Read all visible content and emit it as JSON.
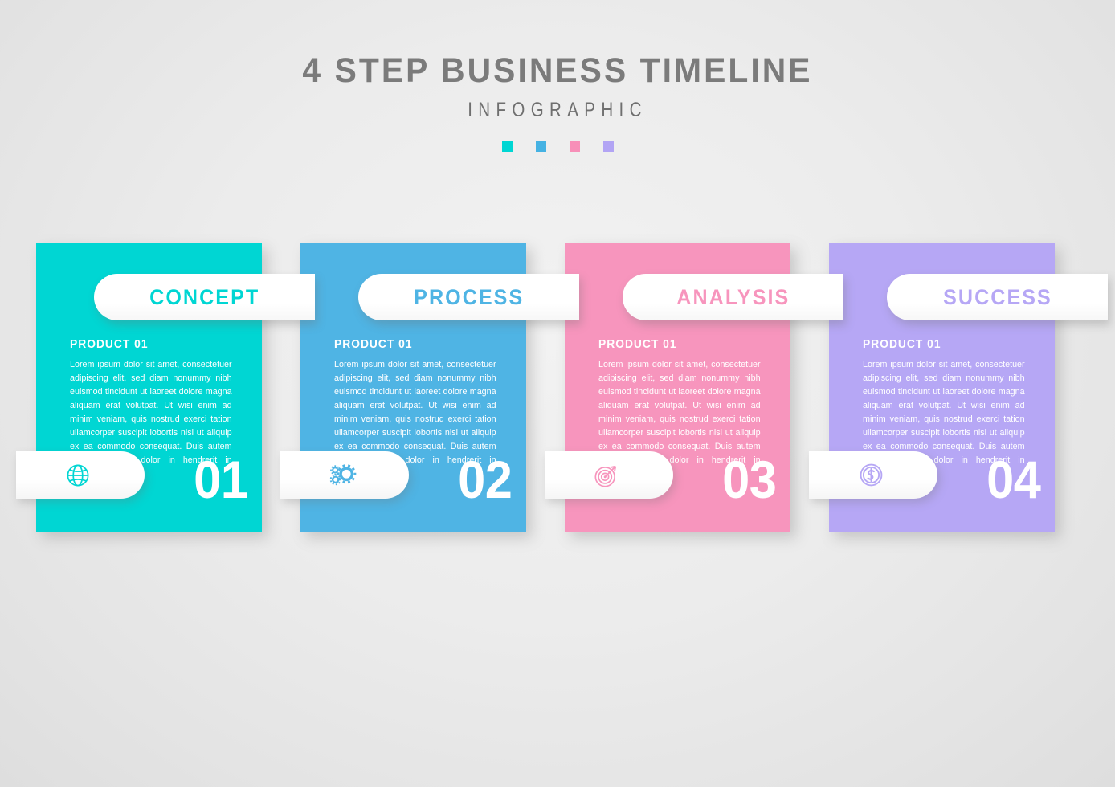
{
  "header": {
    "title": "4 STEP BUSINESS TIMELINE",
    "subtitle": "INFOGRAPHIC",
    "swatches": [
      "#00d6d3",
      "#45b2e3",
      "#f78fb8",
      "#b2a4f4"
    ]
  },
  "palette": {
    "background": "#ececec",
    "card1": "#00d6d3",
    "card2": "#4fb4e4",
    "card3": "#f795bd",
    "card4": "#b6a7f5"
  },
  "cards": [
    {
      "tab_label": "CONCEPT",
      "product_label": "PRODUCT 01",
      "body_text": "Lorem ipsum dolor sit amet, consectetuer adipiscing elit, sed diam nonummy nibh euismod tincidunt ut laoreet dolore magna aliquam erat volutpat. Ut wisi enim ad minim veniam, quis nostrud exerci tation ullamcorper suscipit lobortis nisl ut aliquip ex ea commodo consequat. Duis autem vel eum iriure dolor in hendrerit in vulputate",
      "number": "01",
      "icon": "globe-icon",
      "color": "#00d6d3"
    },
    {
      "tab_label": "PROCESS",
      "product_label": "PRODUCT 01",
      "body_text": "Lorem ipsum dolor sit amet, consectetuer adipiscing elit, sed diam nonummy nibh euismod tincidunt ut laoreet dolore magna aliquam erat volutpat. Ut wisi enim ad minim veniam, quis nostrud exerci tation ullamcorper suscipit lobortis nisl ut aliquip ex ea commodo consequat. Duis autem vel eum iriure dolor in hendrerit in vulputate",
      "number": "02",
      "icon": "gears-icon",
      "color": "#4fb4e4"
    },
    {
      "tab_label": "ANALYSIS",
      "product_label": "PRODUCT 01",
      "body_text": "Lorem ipsum dolor sit amet, consectetuer adipiscing elit, sed diam nonummy nibh euismod tincidunt ut laoreet dolore magna aliquam erat volutpat. Ut wisi enim ad minim veniam, quis nostrud exerci tation ullamcorper suscipit lobortis nisl ut aliquip ex ea commodo consequat. Duis autem vel eum iriure dolor in hendrerit in vulputate",
      "number": "03",
      "icon": "target-icon",
      "color": "#f795bd"
    },
    {
      "tab_label": "SUCCESS",
      "product_label": "PRODUCT 01",
      "body_text": "Lorem ipsum dolor sit amet, consectetuer adipiscing elit, sed diam nonummy nibh euismod tincidunt ut laoreet dolore magna aliquam erat volutpat. Ut wisi enim ad minim veniam, quis nostrud exerci tation ullamcorper suscipit lobortis nisl ut aliquip ex ea commodo consequat. Duis autem vel eum iriure dolor in hendrerit in vulputate",
      "number": "04",
      "icon": "dollar-coin-icon",
      "color": "#b6a7f5"
    }
  ]
}
